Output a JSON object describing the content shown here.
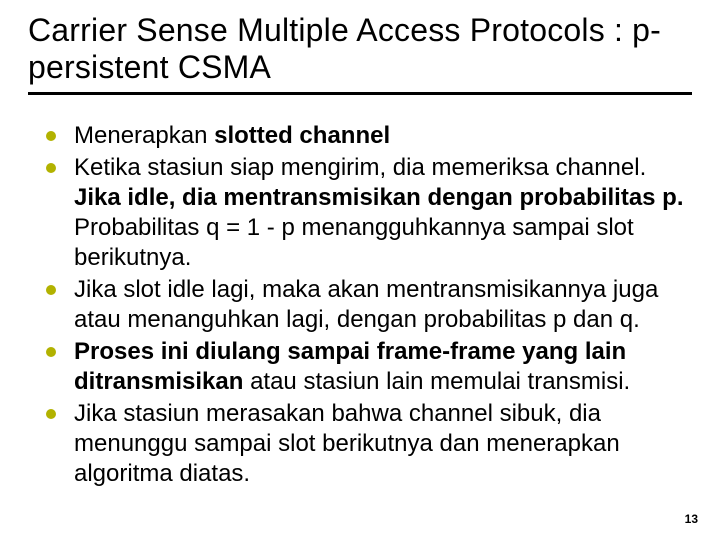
{
  "title": "Carrier Sense Multiple Access Protocols : p-persistent CSMA",
  "bullets": [
    {
      "parts": [
        {
          "t": "Menerapkan ",
          "b": false
        },
        {
          "t": "slotted channel",
          "b": true
        }
      ]
    },
    {
      "parts": [
        {
          "t": "Ketika stasiun siap mengirim, dia memeriksa channel. ",
          "b": false
        },
        {
          "t": "Jika idle, dia mentransmisikan dengan probabilitas p. ",
          "b": true
        },
        {
          "t": "Probabilitas q = 1 - p menangguhkannya sampai slot berikutnya.",
          "b": false
        }
      ]
    },
    {
      "parts": [
        {
          "t": "Jika slot idle lagi, maka akan mentransmisikannya juga atau menanguhkan lagi, dengan probabilitas p dan q.",
          "b": false
        }
      ]
    },
    {
      "parts": [
        {
          "t": "Proses ini diulang sampai frame-frame yang lain ditransmisikan ",
          "b": true
        },
        {
          "t": "atau stasiun lain memulai transmisi.",
          "b": false
        }
      ]
    },
    {
      "parts": [
        {
          "t": "Jika stasiun merasakan bahwa channel sibuk, dia menunggu sampai slot berikutnya dan menerapkan algoritma diatas.",
          "b": false
        }
      ]
    }
  ],
  "page_number": "13"
}
